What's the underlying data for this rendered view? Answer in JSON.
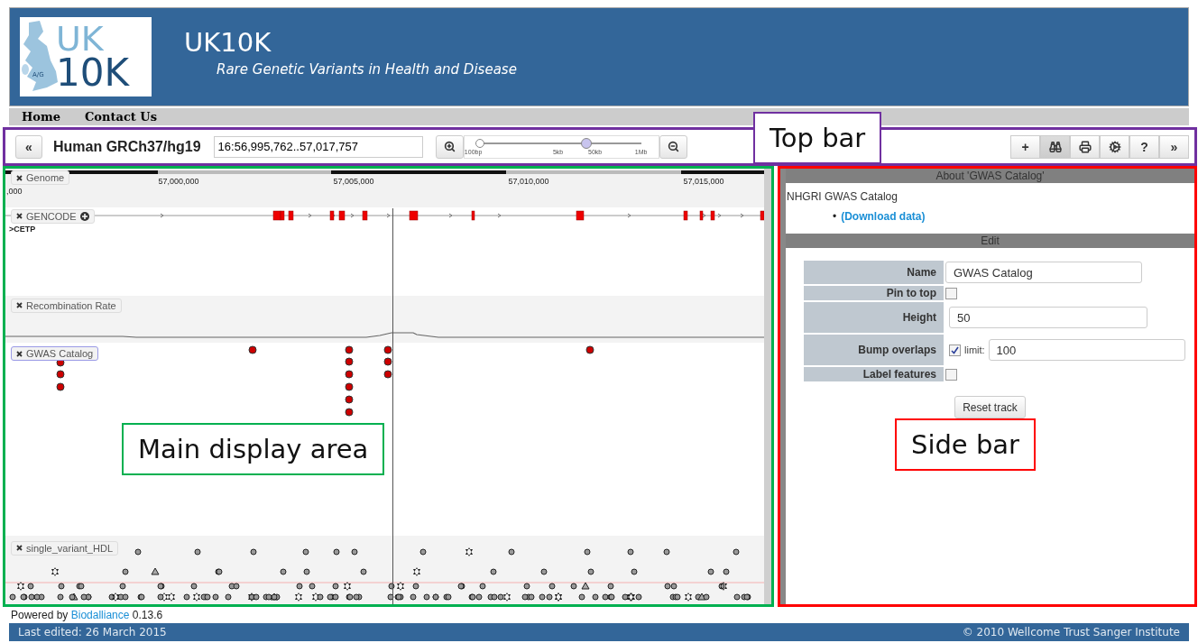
{
  "header": {
    "logo_top": "UK",
    "logo_bottom": "10K",
    "logo_map_text": "A/G",
    "title": "UK10K",
    "subtitle": "Rare Genetic Variants in Health and Disease"
  },
  "nav": [
    "Home",
    "Contact Us"
  ],
  "top_bar": {
    "back": "«",
    "genome": "Human GRCh37/hg19",
    "location": "16:56,995,762..57,017,757",
    "zoom": {
      "level": 0.66,
      "ticks": [
        "100bp",
        "5kb",
        "50kb",
        "1Mb"
      ]
    },
    "tools": [
      {
        "kind": "text",
        "label": "+",
        "selected": false
      },
      {
        "kind": "binoculars",
        "selected": true
      },
      {
        "kind": "print",
        "selected": false
      },
      {
        "kind": "gears",
        "selected": false
      },
      {
        "kind": "text",
        "label": "?",
        "selected": false
      },
      {
        "kind": "text",
        "label": "»",
        "selected": false
      }
    ]
  },
  "tracks": [
    {
      "kind": "ruler",
      "label": "Genome",
      "selected": false,
      "ticks": [
        ",000",
        "57,000,000",
        "57,005,000",
        "57,010,000",
        "57,015,000"
      ]
    },
    {
      "kind": "gene",
      "label": "GENCODE",
      "selected": false,
      "gene": ">CETP"
    },
    {
      "kind": "line",
      "label": "Recombination Rate",
      "selected": false
    },
    {
      "kind": "points",
      "label": "GWAS Catalog",
      "selected": true
    },
    {
      "kind": "variants",
      "label": "single_variant_HDL",
      "selected": false
    }
  ],
  "side_bar": {
    "title": "About 'GWAS Catalog'",
    "description": "NHGRI GWAS Catalog",
    "links": [
      {
        "bullet": "•",
        "text": "(Download data)"
      }
    ],
    "edit_title": "Edit",
    "fields": [
      {
        "kind": "text",
        "label": "Name",
        "value": "GWAS Catalog"
      },
      {
        "kind": "checkbox",
        "label": "Pin to top",
        "checked": false
      },
      {
        "kind": "text",
        "label": "Height",
        "value": "50"
      },
      {
        "kind": "checkbox_limit",
        "label": "Bump overlaps",
        "checked": true,
        "limit_label": "limit:",
        "value": "100"
      },
      {
        "kind": "checkbox",
        "label": "Label features",
        "checked": false
      }
    ],
    "button": "Reset track"
  },
  "footer": {
    "powered_prefix": "Powered by",
    "powered_link": "Biodalliance",
    "version": "0.13.6",
    "last_edited": "Last edited: 26 March 2015",
    "copyright": "© 2010 Wellcome Trust Sanger Institute"
  },
  "annotations": [
    {
      "text": "Top bar",
      "color": "#7030a0"
    },
    {
      "text": "Main display area",
      "color": "#00b050"
    },
    {
      "text": "Side bar",
      "color": "#ff0000"
    }
  ]
}
